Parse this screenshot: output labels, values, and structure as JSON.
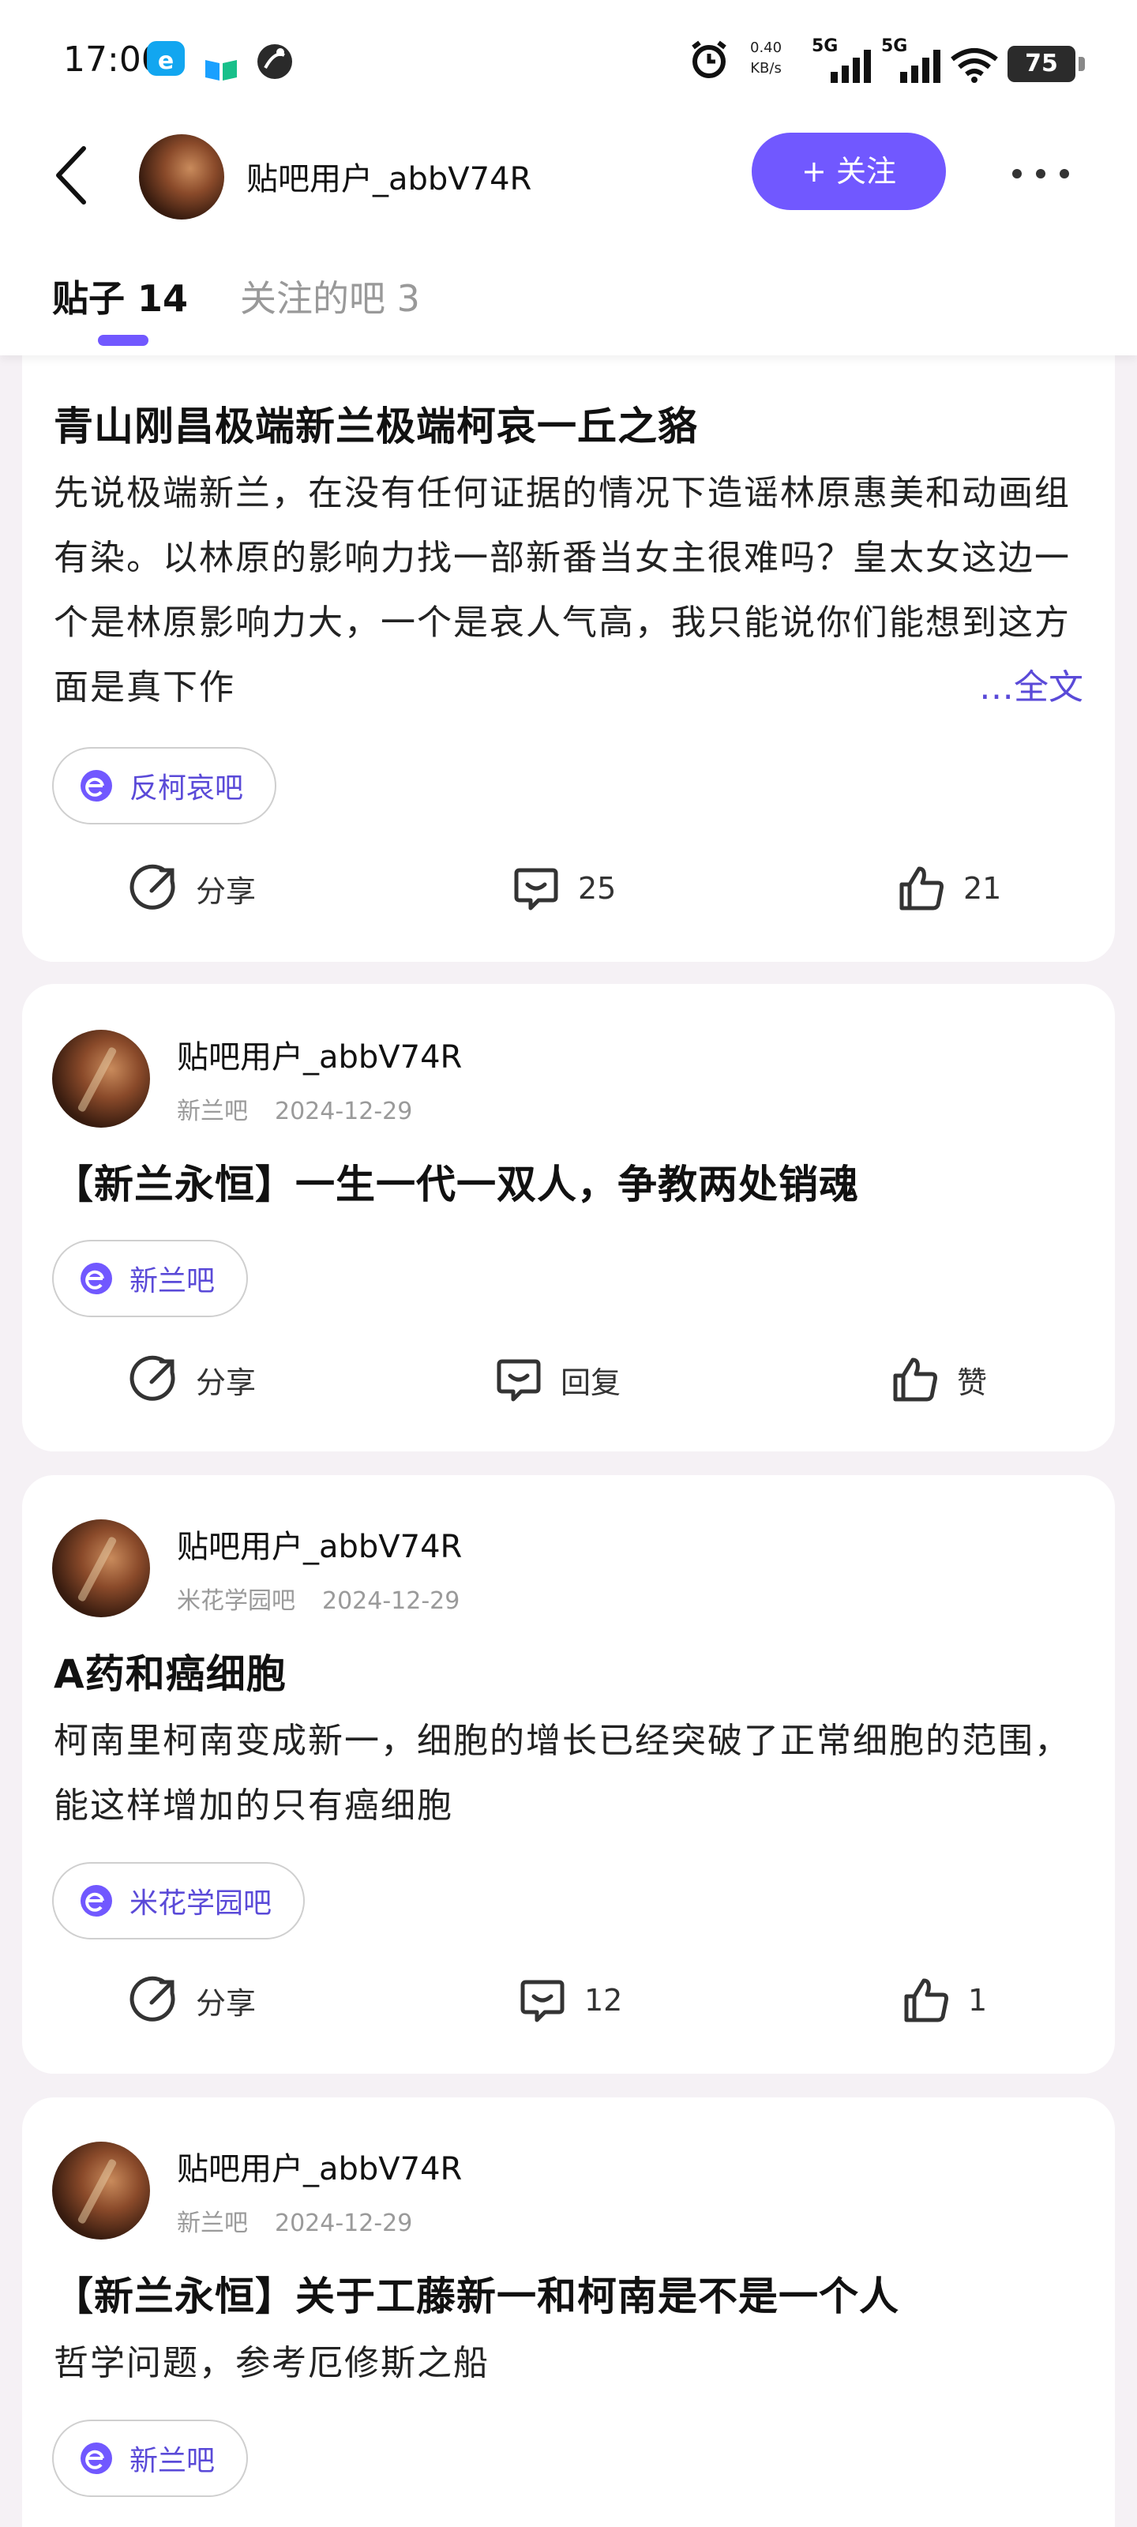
{
  "status_bar": {
    "time": "17:00",
    "net_rate_value": "0.40",
    "net_rate_unit": "KB/s",
    "signal_1": "5G",
    "signal_2": "5G",
    "battery": "75",
    "icons": [
      "edge-app-icon",
      "book-icon",
      "ball-icon",
      "alarm-icon",
      "cellular-signal-icon",
      "wifi-icon"
    ]
  },
  "header": {
    "user_name": "贴吧用户_abbV74R",
    "follow_label": "+ 关注",
    "accent_color": "#7158ff"
  },
  "tabs": [
    {
      "label": "贴子 14"
    },
    {
      "label": "关注的吧 3"
    }
  ],
  "posts": [
    {
      "title": "青山刚昌极端新兰极端柯哀一丘之貉",
      "body": "先说极端新兰，在没有任何证据的情况下造谣林原惠美和动画组有染。以林原的影响力找一部新番当女主很难吗？皇太女这边一个是林原影响力大，一个是哀人气高，我只能说你们能想到这方面是真下作",
      "more_label": "…全文",
      "bar": "反柯哀吧",
      "actions": {
        "share": "分享",
        "comments": "25",
        "likes": "21"
      }
    },
    {
      "author": "贴吧用户_abbV74R",
      "bar_meta": "新兰吧",
      "date": "2024-12-29",
      "title": "【新兰永恒】一生一代一双人，争教两处销魂",
      "bar": "新兰吧",
      "actions": {
        "share": "分享",
        "comments": "回复",
        "likes": "赞"
      }
    },
    {
      "author": "贴吧用户_abbV74R",
      "bar_meta": "米花学园吧",
      "date": "2024-12-29",
      "title": "A药和癌细胞",
      "body": "柯南里柯南变成新一，细胞的增长已经突破了正常细胞的范围，能这样增加的只有癌细胞",
      "bar": "米花学园吧",
      "actions": {
        "share": "分享",
        "comments": "12",
        "likes": "1"
      }
    },
    {
      "author": "贴吧用户_abbV74R",
      "bar_meta": "新兰吧",
      "date": "2024-12-29",
      "title": "【新兰永恒】关于工藤新一和柯南是不是一个人",
      "body": "哲学问题，参考厄修斯之船",
      "bar": "新兰吧"
    }
  ]
}
